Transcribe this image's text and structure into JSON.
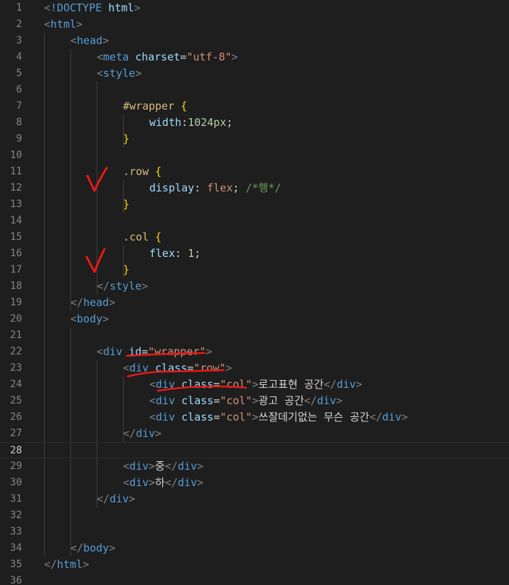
{
  "editor": {
    "lines": [
      {
        "n": "1",
        "indent": 0,
        "tokens": [
          [
            "p",
            "<"
          ],
          [
            "kw",
            "!DOCTYPE"
          ],
          [
            "tx",
            " "
          ],
          [
            "a",
            "html"
          ],
          [
            "p",
            ">"
          ]
        ]
      },
      {
        "n": "2",
        "indent": 0,
        "tokens": [
          [
            "p",
            "<"
          ],
          [
            "t",
            "html"
          ],
          [
            "p",
            ">"
          ]
        ]
      },
      {
        "n": "3",
        "indent": 1,
        "tokens": [
          [
            "p",
            "<"
          ],
          [
            "t",
            "head"
          ],
          [
            "p",
            ">"
          ]
        ]
      },
      {
        "n": "4",
        "indent": 2,
        "tokens": [
          [
            "p",
            "<"
          ],
          [
            "t",
            "meta"
          ],
          [
            "tx",
            " "
          ],
          [
            "a",
            "charset"
          ],
          [
            "tx",
            "="
          ],
          [
            "s",
            "\"utf-8\""
          ],
          [
            "p",
            ">"
          ]
        ]
      },
      {
        "n": "5",
        "indent": 2,
        "tokens": [
          [
            "p",
            "<"
          ],
          [
            "t",
            "style"
          ],
          [
            "p",
            ">"
          ]
        ]
      },
      {
        "n": "6",
        "indent": 0,
        "tokens": []
      },
      {
        "n": "7",
        "indent": 3,
        "tokens": [
          [
            "sel",
            "#wrapper"
          ],
          [
            "tx",
            " "
          ],
          [
            "br",
            "{"
          ]
        ]
      },
      {
        "n": "8",
        "indent": 4,
        "tokens": [
          [
            "a",
            "width"
          ],
          [
            "tx",
            ":"
          ],
          [
            "n",
            "1024px"
          ],
          [
            "tx",
            ";"
          ]
        ]
      },
      {
        "n": "9",
        "indent": 3,
        "tokens": [
          [
            "br",
            "}"
          ]
        ]
      },
      {
        "n": "10",
        "indent": 0,
        "tokens": []
      },
      {
        "n": "11",
        "indent": 3,
        "tokens": [
          [
            "sel",
            ".row"
          ],
          [
            "tx",
            " "
          ],
          [
            "br",
            "{"
          ]
        ]
      },
      {
        "n": "12",
        "indent": 4,
        "tokens": [
          [
            "a",
            "display"
          ],
          [
            "tx",
            ": "
          ],
          [
            "s",
            "flex"
          ],
          [
            "tx",
            "; "
          ],
          [
            "cm",
            "/*행*/"
          ]
        ]
      },
      {
        "n": "13",
        "indent": 3,
        "tokens": [
          [
            "br",
            "}"
          ]
        ]
      },
      {
        "n": "14",
        "indent": 0,
        "tokens": []
      },
      {
        "n": "15",
        "indent": 3,
        "tokens": [
          [
            "sel",
            ".col"
          ],
          [
            "tx",
            " "
          ],
          [
            "br",
            "{"
          ]
        ]
      },
      {
        "n": "16",
        "indent": 4,
        "tokens": [
          [
            "a",
            "flex"
          ],
          [
            "tx",
            ": "
          ],
          [
            "n",
            "1"
          ],
          [
            "tx",
            ";"
          ]
        ]
      },
      {
        "n": "17",
        "indent": 3,
        "tokens": [
          [
            "br",
            "}"
          ]
        ]
      },
      {
        "n": "18",
        "indent": 2,
        "tokens": [
          [
            "p",
            "</"
          ],
          [
            "t",
            "style"
          ],
          [
            "p",
            ">"
          ]
        ]
      },
      {
        "n": "19",
        "indent": 1,
        "tokens": [
          [
            "p",
            "</"
          ],
          [
            "t",
            "head"
          ],
          [
            "p",
            ">"
          ]
        ]
      },
      {
        "n": "20",
        "indent": 1,
        "tokens": [
          [
            "p",
            "<"
          ],
          [
            "t",
            "body"
          ],
          [
            "p",
            ">"
          ]
        ]
      },
      {
        "n": "21",
        "indent": 0,
        "tokens": []
      },
      {
        "n": "22",
        "indent": 2,
        "tokens": [
          [
            "p",
            "<"
          ],
          [
            "t",
            "div"
          ],
          [
            "tx",
            " "
          ],
          [
            "a",
            "id"
          ],
          [
            "tx",
            "="
          ],
          [
            "s",
            "\"wrapper\""
          ],
          [
            "p",
            ">"
          ]
        ]
      },
      {
        "n": "23",
        "indent": 3,
        "tokens": [
          [
            "p",
            "<"
          ],
          [
            "t",
            "div"
          ],
          [
            "tx",
            " "
          ],
          [
            "a",
            "class"
          ],
          [
            "tx",
            "="
          ],
          [
            "s",
            "\"row\""
          ],
          [
            "p",
            ">"
          ]
        ]
      },
      {
        "n": "24",
        "indent": 4,
        "tokens": [
          [
            "p",
            "<"
          ],
          [
            "t",
            "div"
          ],
          [
            "tx",
            " "
          ],
          [
            "a",
            "class"
          ],
          [
            "tx",
            "="
          ],
          [
            "s",
            "\"col\""
          ],
          [
            "p",
            ">"
          ],
          [
            "tx",
            "로고표현 공간"
          ],
          [
            "p",
            "</"
          ],
          [
            "t",
            "div"
          ],
          [
            "p",
            ">"
          ]
        ]
      },
      {
        "n": "25",
        "indent": 4,
        "tokens": [
          [
            "p",
            "<"
          ],
          [
            "t",
            "div"
          ],
          [
            "tx",
            " "
          ],
          [
            "a",
            "class"
          ],
          [
            "tx",
            "="
          ],
          [
            "s",
            "\"col\""
          ],
          [
            "p",
            ">"
          ],
          [
            "tx",
            "광고 공간"
          ],
          [
            "p",
            "</"
          ],
          [
            "t",
            "div"
          ],
          [
            "p",
            ">"
          ]
        ]
      },
      {
        "n": "26",
        "indent": 4,
        "tokens": [
          [
            "p",
            "<"
          ],
          [
            "t",
            "div"
          ],
          [
            "tx",
            " "
          ],
          [
            "a",
            "class"
          ],
          [
            "tx",
            "="
          ],
          [
            "s",
            "\"col\""
          ],
          [
            "p",
            ">"
          ],
          [
            "tx",
            "쓰잘데기없는 무슨 공간"
          ],
          [
            "p",
            "</"
          ],
          [
            "t",
            "div"
          ],
          [
            "p",
            ">"
          ]
        ]
      },
      {
        "n": "27",
        "indent": 3,
        "tokens": [
          [
            "p",
            "</"
          ],
          [
            "t",
            "div"
          ],
          [
            "p",
            ">"
          ]
        ]
      },
      {
        "n": "28",
        "indent": 0,
        "tokens": [],
        "current": true
      },
      {
        "n": "29",
        "indent": 3,
        "tokens": [
          [
            "p",
            "<"
          ],
          [
            "t",
            "div"
          ],
          [
            "p",
            ">"
          ],
          [
            "tx",
            "중"
          ],
          [
            "p",
            "</"
          ],
          [
            "t",
            "div"
          ],
          [
            "p",
            ">"
          ]
        ]
      },
      {
        "n": "30",
        "indent": 3,
        "tokens": [
          [
            "p",
            "<"
          ],
          [
            "t",
            "div"
          ],
          [
            "p",
            ">"
          ],
          [
            "tx",
            "하"
          ],
          [
            "p",
            "</"
          ],
          [
            "t",
            "div"
          ],
          [
            "p",
            ">"
          ]
        ]
      },
      {
        "n": "31",
        "indent": 2,
        "tokens": [
          [
            "p",
            "</"
          ],
          [
            "t",
            "div"
          ],
          [
            "p",
            ">"
          ]
        ]
      },
      {
        "n": "32",
        "indent": 0,
        "tokens": []
      },
      {
        "n": "33",
        "indent": 0,
        "tokens": []
      },
      {
        "n": "34",
        "indent": 1,
        "tokens": [
          [
            "p",
            "</"
          ],
          [
            "t",
            "body"
          ],
          [
            "p",
            ">"
          ]
        ]
      },
      {
        "n": "35",
        "indent": 0,
        "tokens": [
          [
            "p",
            "</"
          ],
          [
            "t",
            "html"
          ],
          [
            "p",
            ">"
          ]
        ]
      },
      {
        "n": "36",
        "indent": 0,
        "tokens": []
      }
    ],
    "colors": {
      "background": "#1e1e1e",
      "annotation": "#e81919"
    }
  }
}
